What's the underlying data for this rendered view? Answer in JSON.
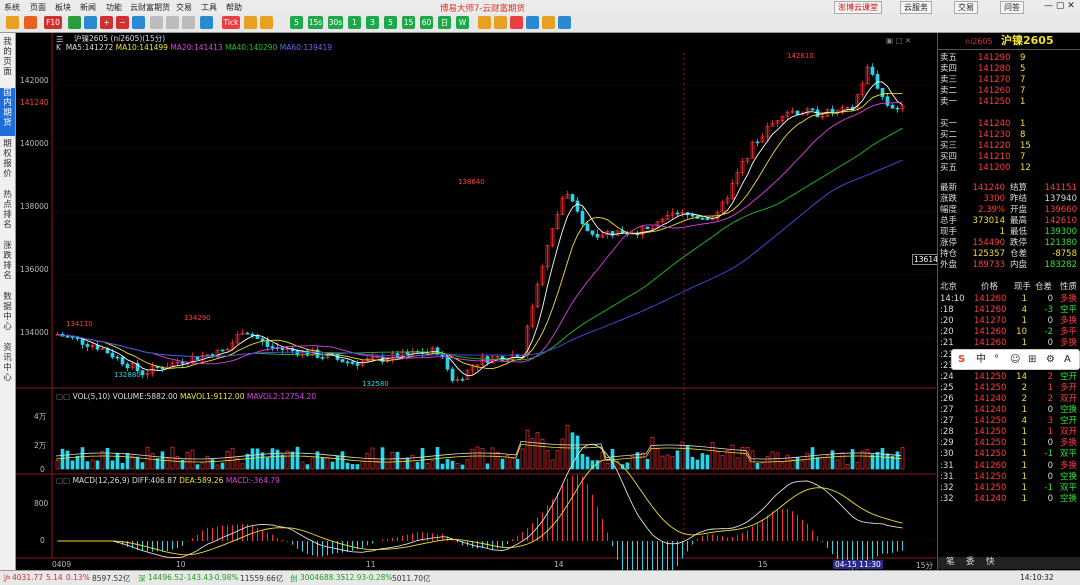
{
  "menu": [
    "系统",
    "页面",
    "板块",
    "新闻",
    "功能",
    "云财富期货",
    "交易",
    "工具",
    "帮助"
  ],
  "app_title": "博易大师7-云财富期货",
  "top_buttons": [
    "澎博云课堂",
    "云服务",
    "交易",
    "问答"
  ],
  "toolbar": {
    "tick": "Tick",
    "periods": [
      "5",
      "15s",
      "30s",
      "1",
      "3",
      "5",
      "15",
      "60",
      "日",
      "W"
    ]
  },
  "sidebar": {
    "tabs": [
      "我的页面",
      "国内期货",
      "期权报价",
      "热点排名",
      "涨跌排名",
      "数据中心",
      "资讯中心"
    ],
    "active": "国内期货"
  },
  "chart": {
    "title": "沪镍2605",
    "period_label": "(ni2605)(15分)",
    "ma_legend": [
      "K",
      "MA5:141272",
      "MA10:141499",
      "MA20:141413",
      "MA40:140290",
      "MA60:139419"
    ],
    "ma_colors": [
      "#ffffff",
      "#f0e030",
      "#e040e0",
      "#20c020",
      "#4a4af0"
    ],
    "price_tags": {
      "high": "142610",
      "left": "134110",
      "mid1": "134290",
      "low1": "132880",
      "low2": "132580",
      "peak2": "138640"
    },
    "yaxis": [
      "142000",
      "141240",
      "140000",
      "138000",
      "136000",
      "134000"
    ],
    "right_tag": "136149",
    "vol_legend": [
      "VOL(5,10)",
      "VOLUME:5882.00",
      "MAVOL1:9112.00",
      "MAVOL2:12754.20"
    ],
    "vol_yaxis": [
      "4万",
      "2万",
      "0"
    ],
    "macd_legend": [
      "MACD(12,26,9)",
      "DIFF:406.87",
      "DEA:589.26",
      "MACD:-364.79"
    ],
    "macd_yaxis": [
      "800",
      "0"
    ],
    "xaxis": [
      "0409",
      "10",
      "11",
      "14",
      "15"
    ],
    "cursor_time": "04-15 11:30",
    "period_short": "15分"
  },
  "chart_data": {
    "type": "candlestick",
    "symbol": "ni2605",
    "ylim": [
      132500,
      142700
    ],
    "close_path": [
      [
        0,
        134110
      ],
      [
        0.05,
        133700
      ],
      [
        0.1,
        132880
      ],
      [
        0.15,
        133300
      ],
      [
        0.2,
        133600
      ],
      [
        0.22,
        134290
      ],
      [
        0.25,
        133700
      ],
      [
        0.3,
        133500
      ],
      [
        0.35,
        133200
      ],
      [
        0.4,
        133400
      ],
      [
        0.45,
        133600
      ],
      [
        0.47,
        132580
      ],
      [
        0.5,
        133300
      ],
      [
        0.55,
        133500
      ],
      [
        0.57,
        136000
      ],
      [
        0.6,
        138640
      ],
      [
        0.63,
        137300
      ],
      [
        0.7,
        137400
      ],
      [
        0.73,
        137900
      ],
      [
        0.78,
        137800
      ],
      [
        0.82,
        140000
      ],
      [
        0.86,
        141200
      ],
      [
        0.9,
        141100
      ],
      [
        0.94,
        141200
      ],
      [
        0.96,
        142610
      ],
      [
        0.98,
        141400
      ],
      [
        1.0,
        141240
      ]
    ]
  },
  "quote": {
    "contract": "ni2605",
    "name": "沪镍2605",
    "asks": [
      [
        "卖五",
        "141290",
        "9"
      ],
      [
        "卖四",
        "141280",
        "5"
      ],
      [
        "卖三",
        "141270",
        "7"
      ],
      [
        "卖二",
        "141260",
        "7"
      ],
      [
        "卖一",
        "141250",
        "1"
      ]
    ],
    "bids": [
      [
        "买一",
        "141240",
        "1"
      ],
      [
        "买二",
        "141230",
        "8"
      ],
      [
        "买三",
        "141220",
        "15"
      ],
      [
        "买四",
        "141210",
        "7"
      ],
      [
        "买五",
        "141200",
        "12"
      ]
    ],
    "stats": [
      [
        "最新",
        "141240",
        "结算",
        "141151"
      ],
      [
        "涨跌",
        "3300",
        "昨结",
        "137940"
      ],
      [
        "幅度",
        "2.39%",
        "开盘",
        "139660"
      ],
      [
        "总手",
        "373014",
        "最高",
        "142610"
      ],
      [
        "现手",
        "1",
        "最低",
        "139300"
      ],
      [
        "涨停",
        "154490",
        "跌停",
        "121380"
      ],
      [
        "持仓",
        "125357",
        "仓差",
        "-8758"
      ],
      [
        "外盘",
        "189733",
        "内盘",
        "183282"
      ]
    ],
    "ticks_header": [
      "北京",
      "价格",
      "现手",
      "仓差",
      "性质"
    ],
    "ticks": [
      [
        "14:10",
        "141260",
        "1",
        "0",
        "多换"
      ],
      [
        ":18",
        "141260",
        "4",
        "-3",
        "空平"
      ],
      [
        ":20",
        "141270",
        "1",
        "0",
        "多换"
      ],
      [
        ":20",
        "141260",
        "10",
        "-2",
        "多平"
      ],
      [
        ":21",
        "141260",
        "1",
        "0",
        "多换"
      ],
      [
        ":23",
        "141250",
        "1",
        "0",
        "空换"
      ],
      [
        ":23",
        "141250",
        "11",
        "-4",
        "多平"
      ],
      [
        ":24",
        "141250",
        "14",
        "2",
        "空开"
      ],
      [
        ":25",
        "141250",
        "2",
        "1",
        "多开"
      ],
      [
        ":26",
        "141240",
        "2",
        "2",
        "双开"
      ],
      [
        ":27",
        "141240",
        "1",
        "0",
        "空换"
      ],
      [
        ":27",
        "141250",
        "4",
        "3",
        "空开"
      ],
      [
        ":28",
        "141250",
        "1",
        "1",
        "双开"
      ],
      [
        ":29",
        "141250",
        "1",
        "0",
        "多换"
      ],
      [
        ":30",
        "141250",
        "1",
        "-1",
        "双平"
      ],
      [
        ":31",
        "141260",
        "1",
        "0",
        "多换"
      ],
      [
        ":31",
        "141250",
        "1",
        "0",
        "空换"
      ],
      [
        ":32",
        "141250",
        "1",
        "-1",
        "双平"
      ],
      [
        ":32",
        "141240",
        "1",
        "0",
        "空换"
      ]
    ],
    "tabs": [
      "笔",
      "委",
      "快"
    ]
  },
  "ime": [
    "S",
    "中",
    "°",
    "☺",
    "⊞",
    "⚙",
    "A"
  ],
  "statusbar": [
    {
      "label": "沪",
      "value": "4031.77",
      "chg": "5.14",
      "pct": "0.13%",
      "amt": "8597.52亿"
    },
    {
      "label": "深",
      "value": "14496.52",
      "chg": "-143.43",
      "pct": "-0.98%",
      "amt": "11559.66亿"
    },
    {
      "label": "创",
      "value": "3004688.35",
      "chg": "-12.93",
      "pct": "-0.28%",
      "amt": "5011.70亿"
    }
  ],
  "clock": "14:10:32"
}
